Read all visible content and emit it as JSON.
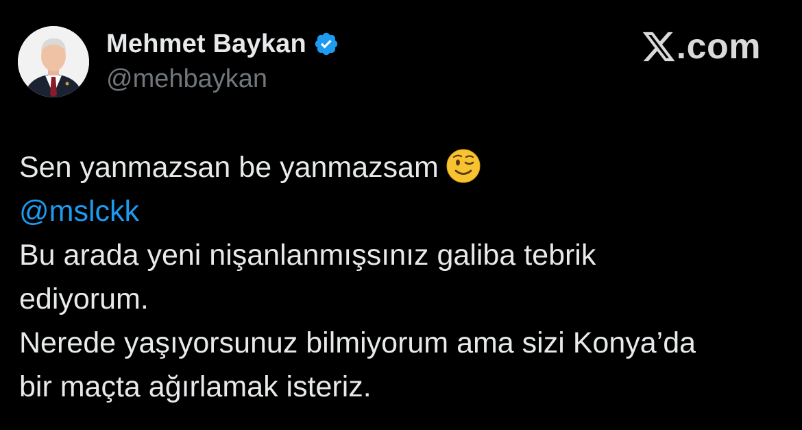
{
  "author": {
    "display_name": "Mehmet Baykan",
    "handle": "@mehbaykan",
    "verified": true,
    "verified_color": "#1d9bf0",
    "avatar_icon": "profile-photo"
  },
  "brand": {
    "text": ".com",
    "logo_icon": "x-logo-icon"
  },
  "tweet": {
    "line1": "Sen yanmazsan be yanmazsam",
    "line1_emoji": "winking-face-emoji",
    "mention": "@mslckk",
    "line3": "Bu arada yeni nişanlanmışsınız galiba tebrik",
    "line4": "ediyorum.",
    "line5": "Nerede yaşıyorsunuz bilmiyorum ama sizi Konya’da",
    "line6": "bir maçta ağırlamak isteriz."
  },
  "colors": {
    "background": "#000000",
    "text": "#e7e9ea",
    "secondary": "#71767b",
    "link": "#1d9bf0"
  }
}
